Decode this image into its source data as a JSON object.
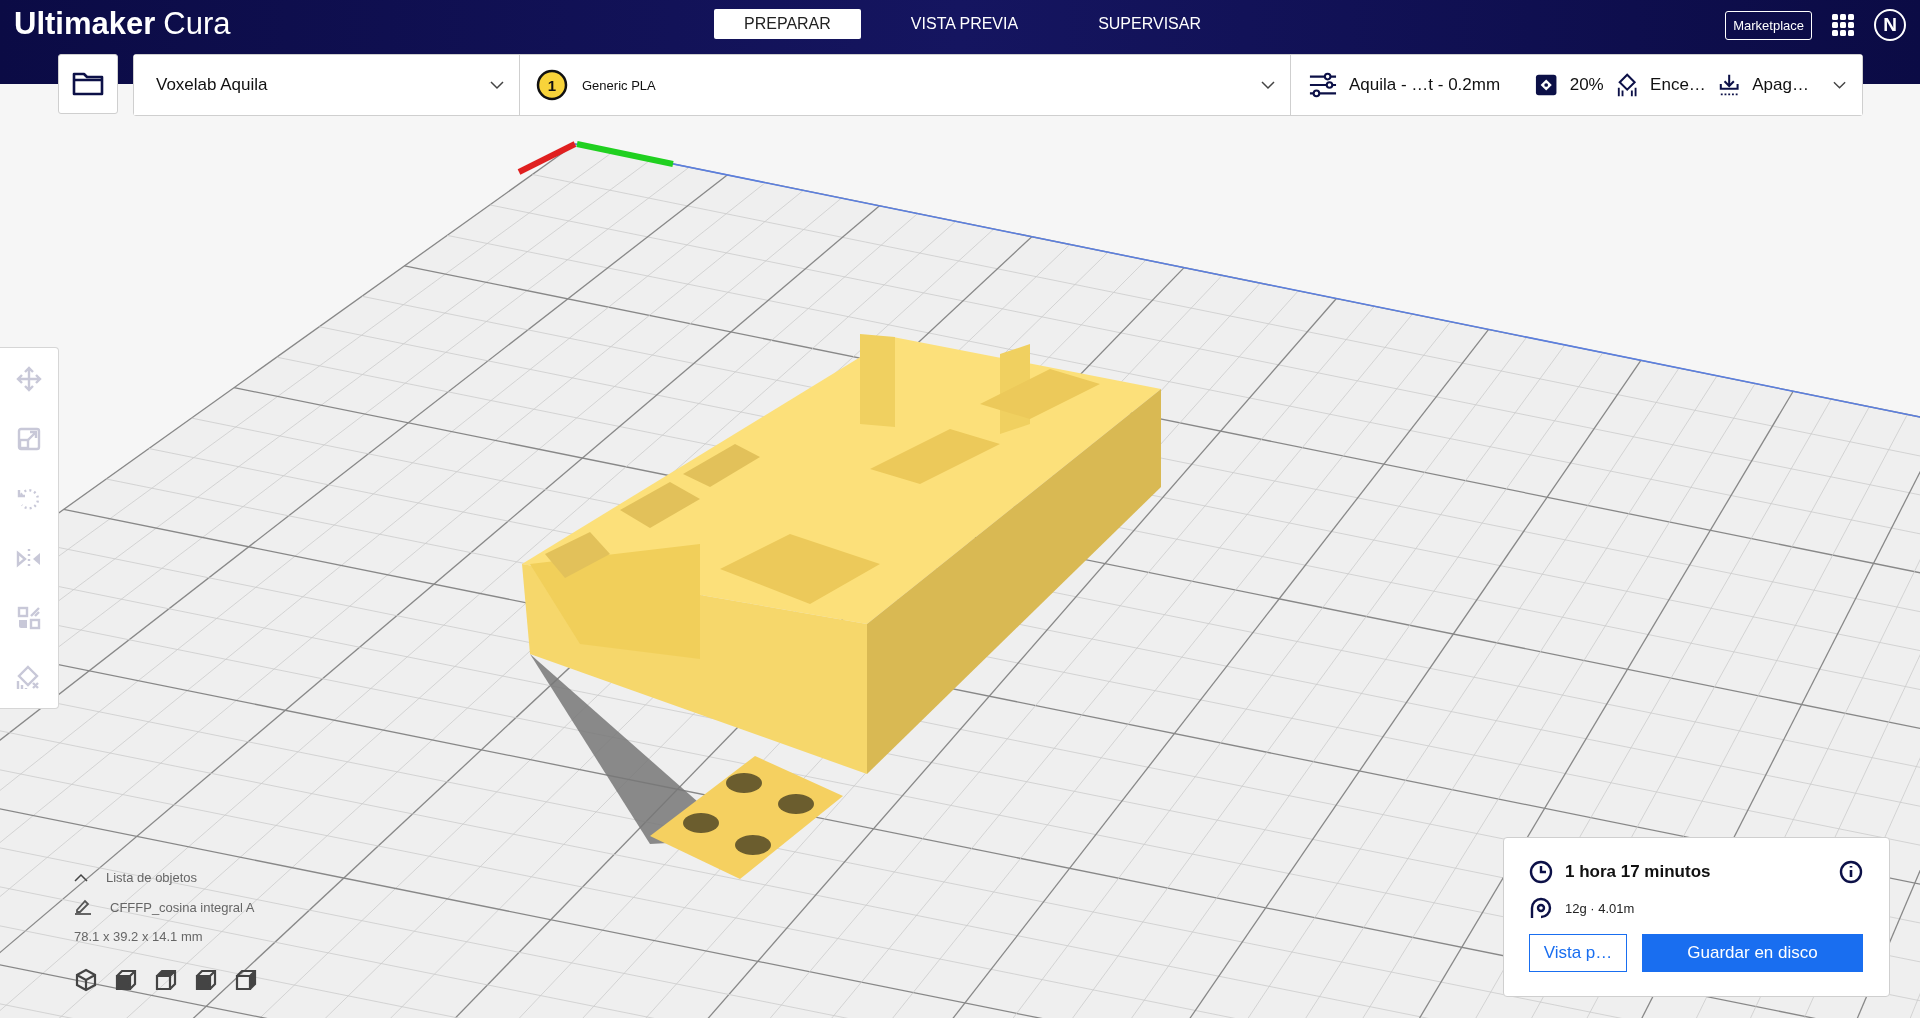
{
  "app": {
    "title_bold": "Ultimaker",
    "title_light": "Cura"
  },
  "tabs": [
    {
      "label": "PREPARAR",
      "selected": true
    },
    {
      "label": "VISTA PREVIA",
      "selected": false
    },
    {
      "label": "SUPERVISAR",
      "selected": false
    }
  ],
  "marketplace": "Marketplace",
  "account_initial": "N",
  "printer": {
    "name": "Voxelab Aquila"
  },
  "material": {
    "extruder": "1",
    "name": "Generic PLA"
  },
  "print_settings": {
    "profile": "Aquila - …t - 0.2mm",
    "infill": "20%",
    "support": "Ence…",
    "adhesion": "Apag…"
  },
  "tools": [
    {
      "kind": "move",
      "disabled": true
    },
    {
      "kind": "scale",
      "disabled": true
    },
    {
      "kind": "rotate",
      "disabled": true
    },
    {
      "kind": "mirror",
      "disabled": true
    },
    {
      "kind": "per-model",
      "disabled": true
    },
    {
      "kind": "support-blocker",
      "disabled": true
    }
  ],
  "object_list": {
    "label": "Lista de objetos",
    "object_name": "CFFFP_cosina integral A",
    "dimensions": "78.1 x 39.2 x 14.1 mm"
  },
  "print_panel": {
    "time": "1 hora 17 minutos",
    "usage": "12g · 4.01m",
    "preview_button": "Vista p…",
    "save_button": "Guardar en disco"
  }
}
